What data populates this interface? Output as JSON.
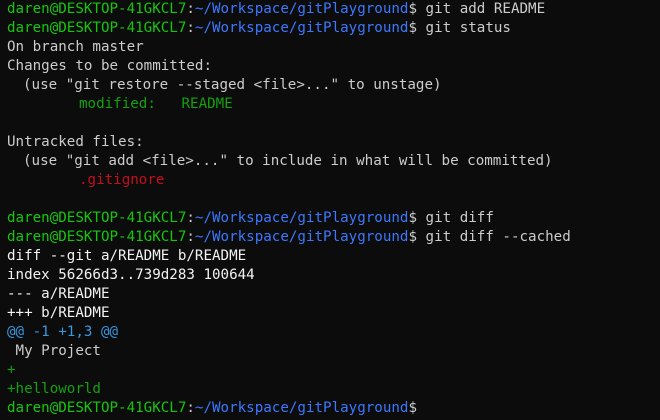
{
  "theme": {
    "background": "#0c0c0c",
    "foreground": "#cccccc",
    "prompt_user_color": "#16c60c",
    "prompt_path_color": "#3b78ff",
    "staged_color": "#13a10e",
    "untracked_color": "#c50f1f",
    "hunk_header_color": "#3a96dd",
    "diff_add_color": "#13a10e",
    "header_text_color": "#f2f2f2"
  },
  "prompt": {
    "user_host": "daren@DESKTOP-41GKCL7",
    "colon": ":",
    "path": "~/Workspace/gitPlayground",
    "symbol": "$"
  },
  "lines": [
    {
      "type": "prompt",
      "command": " git add README"
    },
    {
      "type": "prompt",
      "command": " git status"
    },
    {
      "type": "text",
      "text": "On branch master"
    },
    {
      "type": "text",
      "text": "Changes to be committed:"
    },
    {
      "type": "text",
      "indent": 1,
      "text": "(use \"git restore --staged <file>...\" to unstage)"
    },
    {
      "type": "text",
      "indent": 2,
      "color": "#13a10e",
      "text": "modified:   README"
    },
    {
      "type": "blank"
    },
    {
      "type": "text",
      "text": "Untracked files:"
    },
    {
      "type": "text",
      "indent": 1,
      "text": "(use \"git add <file>...\" to include in what will be committed)"
    },
    {
      "type": "text",
      "indent": 2,
      "color": "#c50f1f",
      "text": ".gitignore"
    },
    {
      "type": "blank"
    },
    {
      "type": "prompt",
      "command": " git diff"
    },
    {
      "type": "prompt",
      "command": " git diff --cached"
    },
    {
      "type": "text",
      "color": "#f2f2f2",
      "text": "diff --git a/README b/README"
    },
    {
      "type": "text",
      "color": "#f2f2f2",
      "text": "index 56266d3..739d283 100644"
    },
    {
      "type": "text",
      "color": "#f2f2f2",
      "text": "--- a/README"
    },
    {
      "type": "text",
      "color": "#f2f2f2",
      "text": "+++ b/README"
    },
    {
      "type": "text",
      "color": "#3a96dd",
      "text": "@@ -1 +1,3 @@"
    },
    {
      "type": "text",
      "text": " My Project"
    },
    {
      "type": "text",
      "color": "#13a10e",
      "text": "+"
    },
    {
      "type": "text",
      "color": "#13a10e",
      "text": "+helloworld"
    },
    {
      "type": "prompt",
      "command": "",
      "cursor": true
    }
  ]
}
